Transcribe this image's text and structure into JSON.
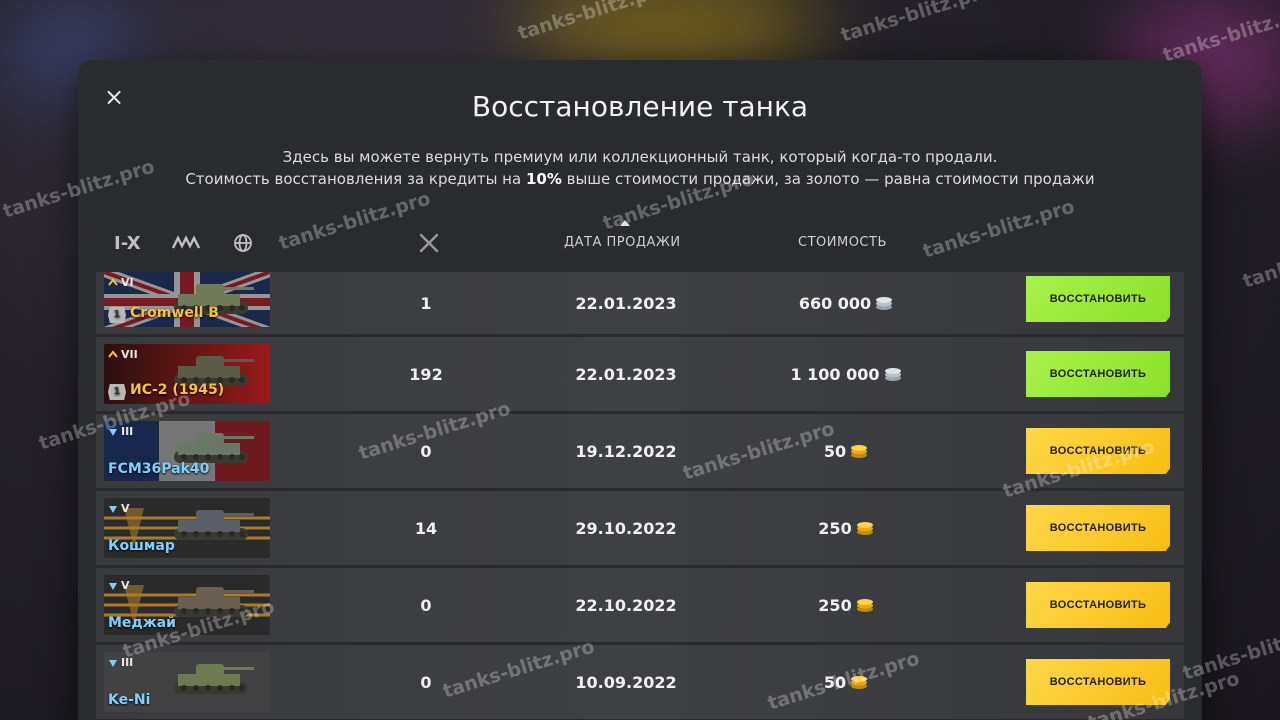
{
  "modal": {
    "close_symbol": "×",
    "title": "Восстановление танка",
    "description_line1": "Здесь вы можете вернуть премиум или коллекционный танк, который когда-то продали.",
    "description_line2_pre": "Стоимость восстановления за кредиты на ",
    "description_line2_bold": "10%",
    "description_line2_post": " выше стоимости продажи, за золото — равна стоимости продажи"
  },
  "filters": {
    "tier_label": "I-X",
    "nation_icon": "nation-filter-icon",
    "globe_icon": "globe-icon"
  },
  "columns": {
    "battles_icon": "crossed-swords-icon",
    "sale_date": "ДАТА ПРОДАЖИ",
    "cost": "СТОИМОСТЬ"
  },
  "rows": [
    {
      "tier": "VI",
      "name": "Cromwell B",
      "name_color": "#f5c242",
      "premium": "1",
      "battles": "1",
      "date": "22.01.2023",
      "cost": "660 000",
      "currency": "credits",
      "button": "ВОССТАНОВИТЬ",
      "button_color": "green",
      "flag": "uk"
    },
    {
      "tier": "VII",
      "name": "ИС-2 (1945)",
      "name_color": "#f5c242",
      "premium": "1",
      "battles": "192",
      "date": "22.01.2023",
      "cost": "1 100 000",
      "currency": "credits",
      "button": "ВОССТАНОВИТЬ",
      "button_color": "green",
      "flag": "ussr"
    },
    {
      "tier": "III",
      "name": "FCM36Pak40",
      "name_color": "#7fd0ff",
      "premium": "",
      "battles": "0",
      "date": "19.12.2022",
      "cost": "50",
      "currency": "gold",
      "button": "ВОССТАНОВИТЬ",
      "button_color": "yellow",
      "flag": "fr"
    },
    {
      "tier": "V",
      "name": "Кошмар",
      "name_color": "#7fd0ff",
      "premium": "",
      "battles": "14",
      "date": "29.10.2022",
      "cost": "250",
      "currency": "gold",
      "button": "ВОССТАНОВИТЬ",
      "button_color": "yellow",
      "flag": "de"
    },
    {
      "tier": "V",
      "name": "Меджай",
      "name_color": "#7fd0ff",
      "premium": "",
      "battles": "0",
      "date": "22.10.2022",
      "cost": "250",
      "currency": "gold",
      "button": "ВОССТАНОВИТЬ",
      "button_color": "yellow",
      "flag": "de"
    },
    {
      "tier": "III",
      "name": "Ke-Ni",
      "name_color": "#7fd0ff",
      "premium": "",
      "battles": "0",
      "date": "10.09.2022",
      "cost": "50",
      "currency": "gold",
      "button": "ВОССТАНОВИТЬ",
      "button_color": "yellow",
      "flag": "jp"
    }
  ],
  "watermark_text": "tanks-blitz.pro"
}
